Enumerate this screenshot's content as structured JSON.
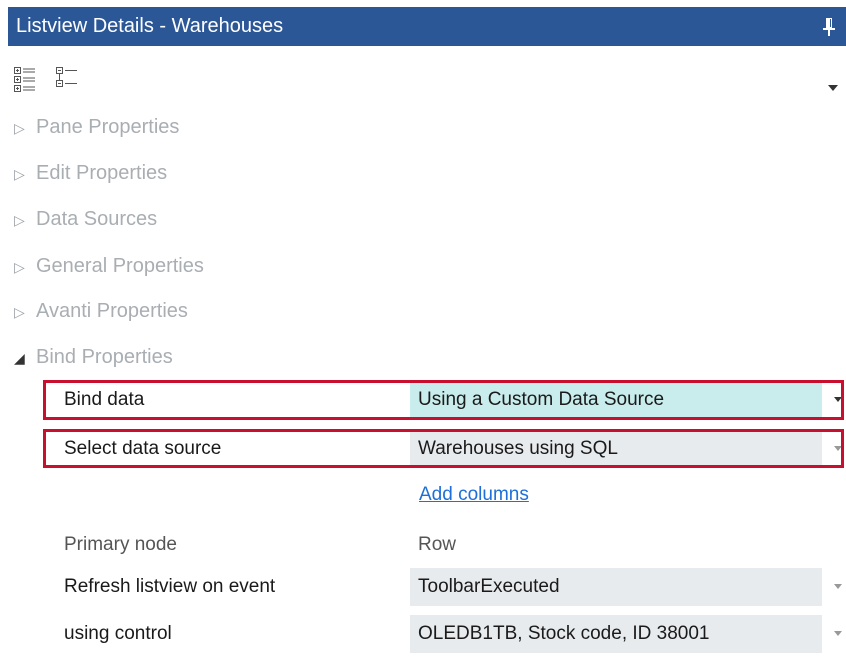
{
  "window": {
    "title": "Listview Details - Warehouses"
  },
  "toolbar": {
    "icons": [
      "expand-all-icon",
      "collapse-all-icon"
    ]
  },
  "sections": [
    {
      "label": "Pane Properties",
      "expanded": false
    },
    {
      "label": "Edit Properties",
      "expanded": false
    },
    {
      "label": "Data Sources",
      "expanded": false
    },
    {
      "label": "General Properties",
      "expanded": false
    },
    {
      "label": "Avanti Properties",
      "expanded": false
    },
    {
      "label": "Bind Properties",
      "expanded": true
    }
  ],
  "bind_properties": {
    "bind_data": {
      "label": "Bind data",
      "value": "Using a Custom Data Source"
    },
    "select_data_source": {
      "label": "Select data source",
      "value": "Warehouses using SQL"
    },
    "add_columns_link": "Add columns",
    "primary_node": {
      "label": "Primary node",
      "value": "Row"
    },
    "refresh_on_event": {
      "label": "Refresh listview on event",
      "value": "ToolbarExecuted"
    },
    "using_control": {
      "label": "using control",
      "value": "OLEDB1TB, Stock code, ID 38001"
    }
  },
  "colors": {
    "title_bar": "#2b5797",
    "highlight_border": "#c8102e",
    "selected_value_bg": "#c9ecec",
    "value_bg": "#e8ebed",
    "link": "#1e6fd9"
  }
}
